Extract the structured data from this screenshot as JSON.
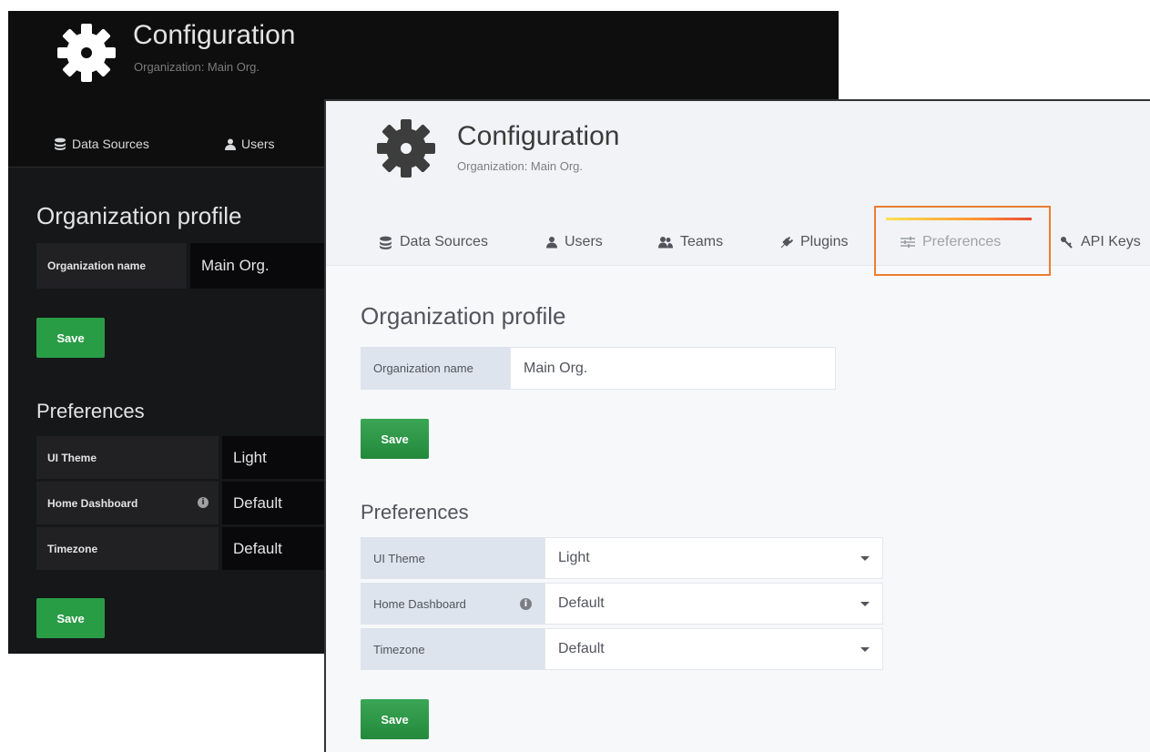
{
  "dark_window": {
    "title": "Configuration",
    "subtitle": "Organization: Main Org.",
    "tabs": [
      {
        "label": "Data Sources",
        "icon": "database-icon"
      },
      {
        "label": "Users",
        "icon": "user-icon"
      }
    ],
    "org_profile_heading": "Organization profile",
    "org_name_label": "Organization name",
    "org_name_value": "Main Org.",
    "save_label": "Save",
    "preferences_heading": "Preferences",
    "prefs": [
      {
        "label": "UI Theme",
        "value": "Light"
      },
      {
        "label": "Home Dashboard",
        "value": "Default"
      },
      {
        "label": "Timezone",
        "value": "Default"
      }
    ],
    "save2_label": "Save"
  },
  "light_window": {
    "title": "Configuration",
    "subtitle": "Organization: Main Org.",
    "tabs": [
      {
        "label": "Data Sources",
        "icon": "database-icon"
      },
      {
        "label": "Users",
        "icon": "user-icon"
      },
      {
        "label": "Teams",
        "icon": "users-icon"
      },
      {
        "label": "Plugins",
        "icon": "plug-icon"
      },
      {
        "label": "Preferences",
        "icon": "sliders-icon",
        "active": true
      },
      {
        "label": "API Keys",
        "icon": "key-icon"
      }
    ],
    "org_profile_heading": "Organization profile",
    "org_name_label": "Organization name",
    "org_name_value": "Main Org.",
    "save_label": "Save",
    "preferences_heading": "Preferences",
    "prefs": [
      {
        "label": "UI Theme",
        "value": "Light"
      },
      {
        "label": "Home Dashboard",
        "value": "Default"
      },
      {
        "label": "Timezone",
        "value": "Default"
      }
    ],
    "save2_label": "Save"
  },
  "colors": {
    "accent_green": "#299c46",
    "highlight_orange": "#ed7d31",
    "dark_bg": "#161719",
    "light_bg": "#f7f8fa"
  }
}
